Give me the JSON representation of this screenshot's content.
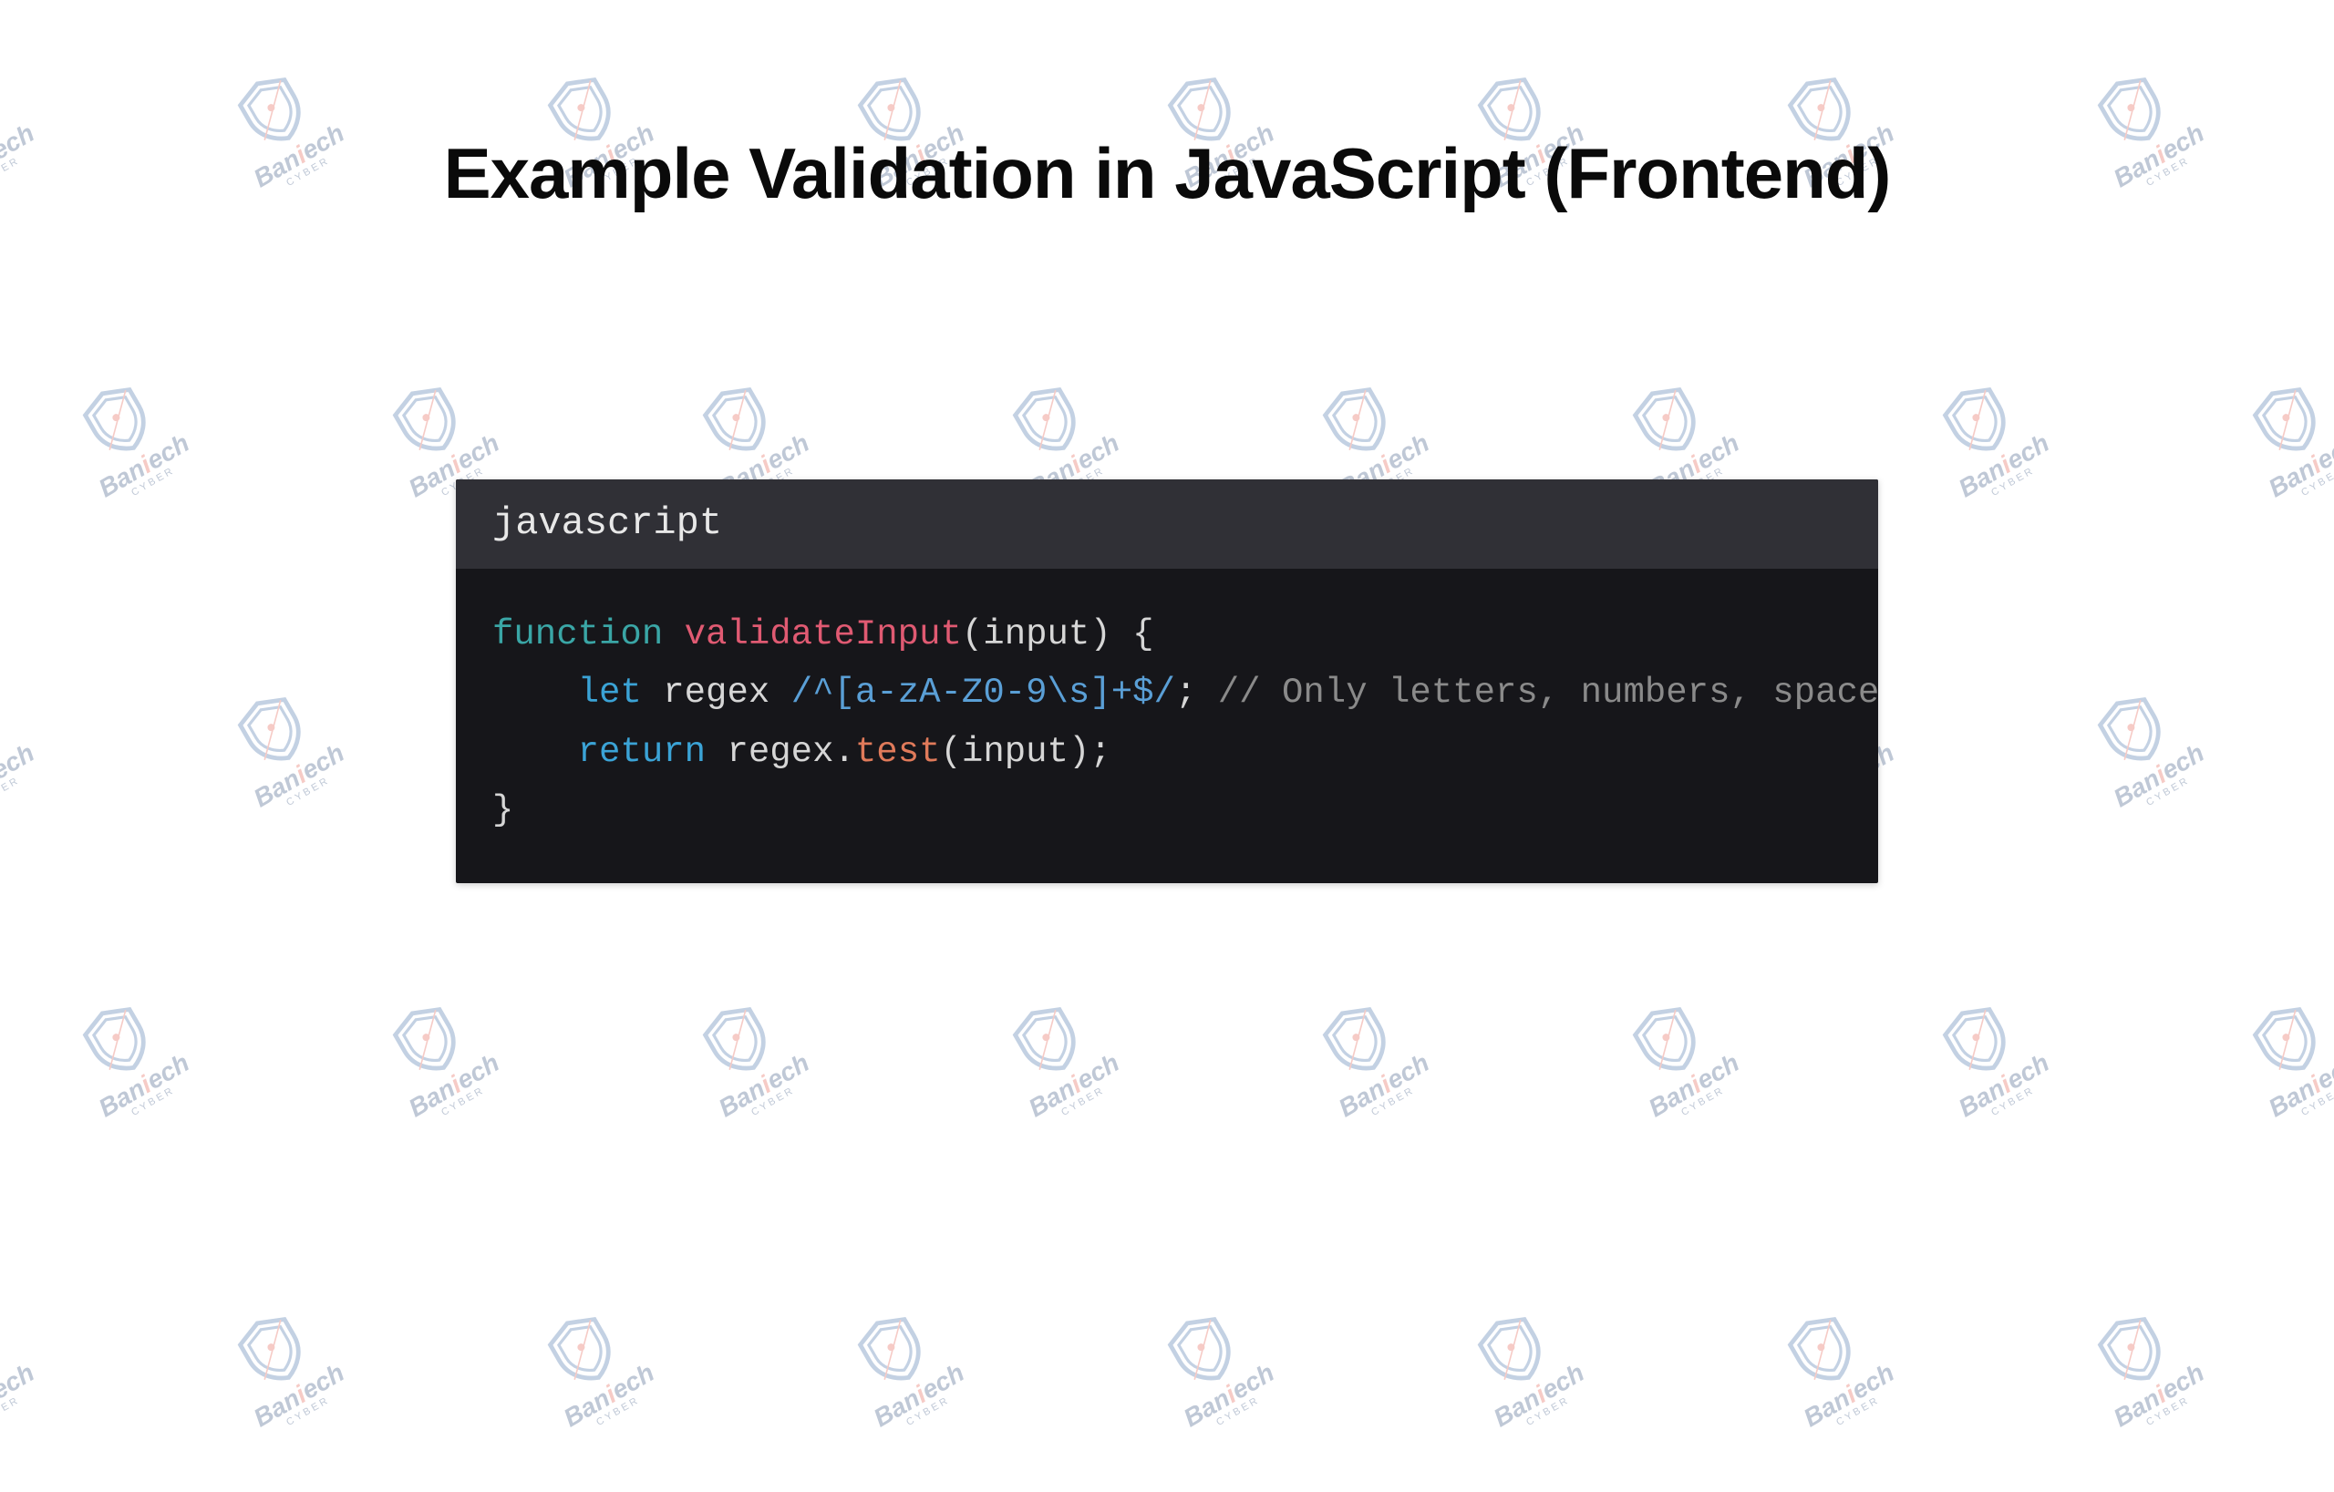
{
  "title": "Example Validation in JavaScript (Frontend)",
  "watermark": {
    "brand_plain": "Ban",
    "brand_hl": "i",
    "brand_tail": "ech",
    "sub": "CYBER"
  },
  "code": {
    "language": "javascript",
    "l1_kw": "function",
    "l1_fn": "validateInput",
    "l1_rest": "(input) {",
    "l2_kw": "let",
    "l2_id": "regex ",
    "l2_re": "/^[a-zA-Z0-9\\s]+$/",
    "l2_semi": ";",
    "l2_cm": "// Only letters, numbers, spaces",
    "l3_kw": "return",
    "l3_obj": "regex.",
    "l3_call": "test",
    "l3_rest": "(input);",
    "l4": "}"
  }
}
